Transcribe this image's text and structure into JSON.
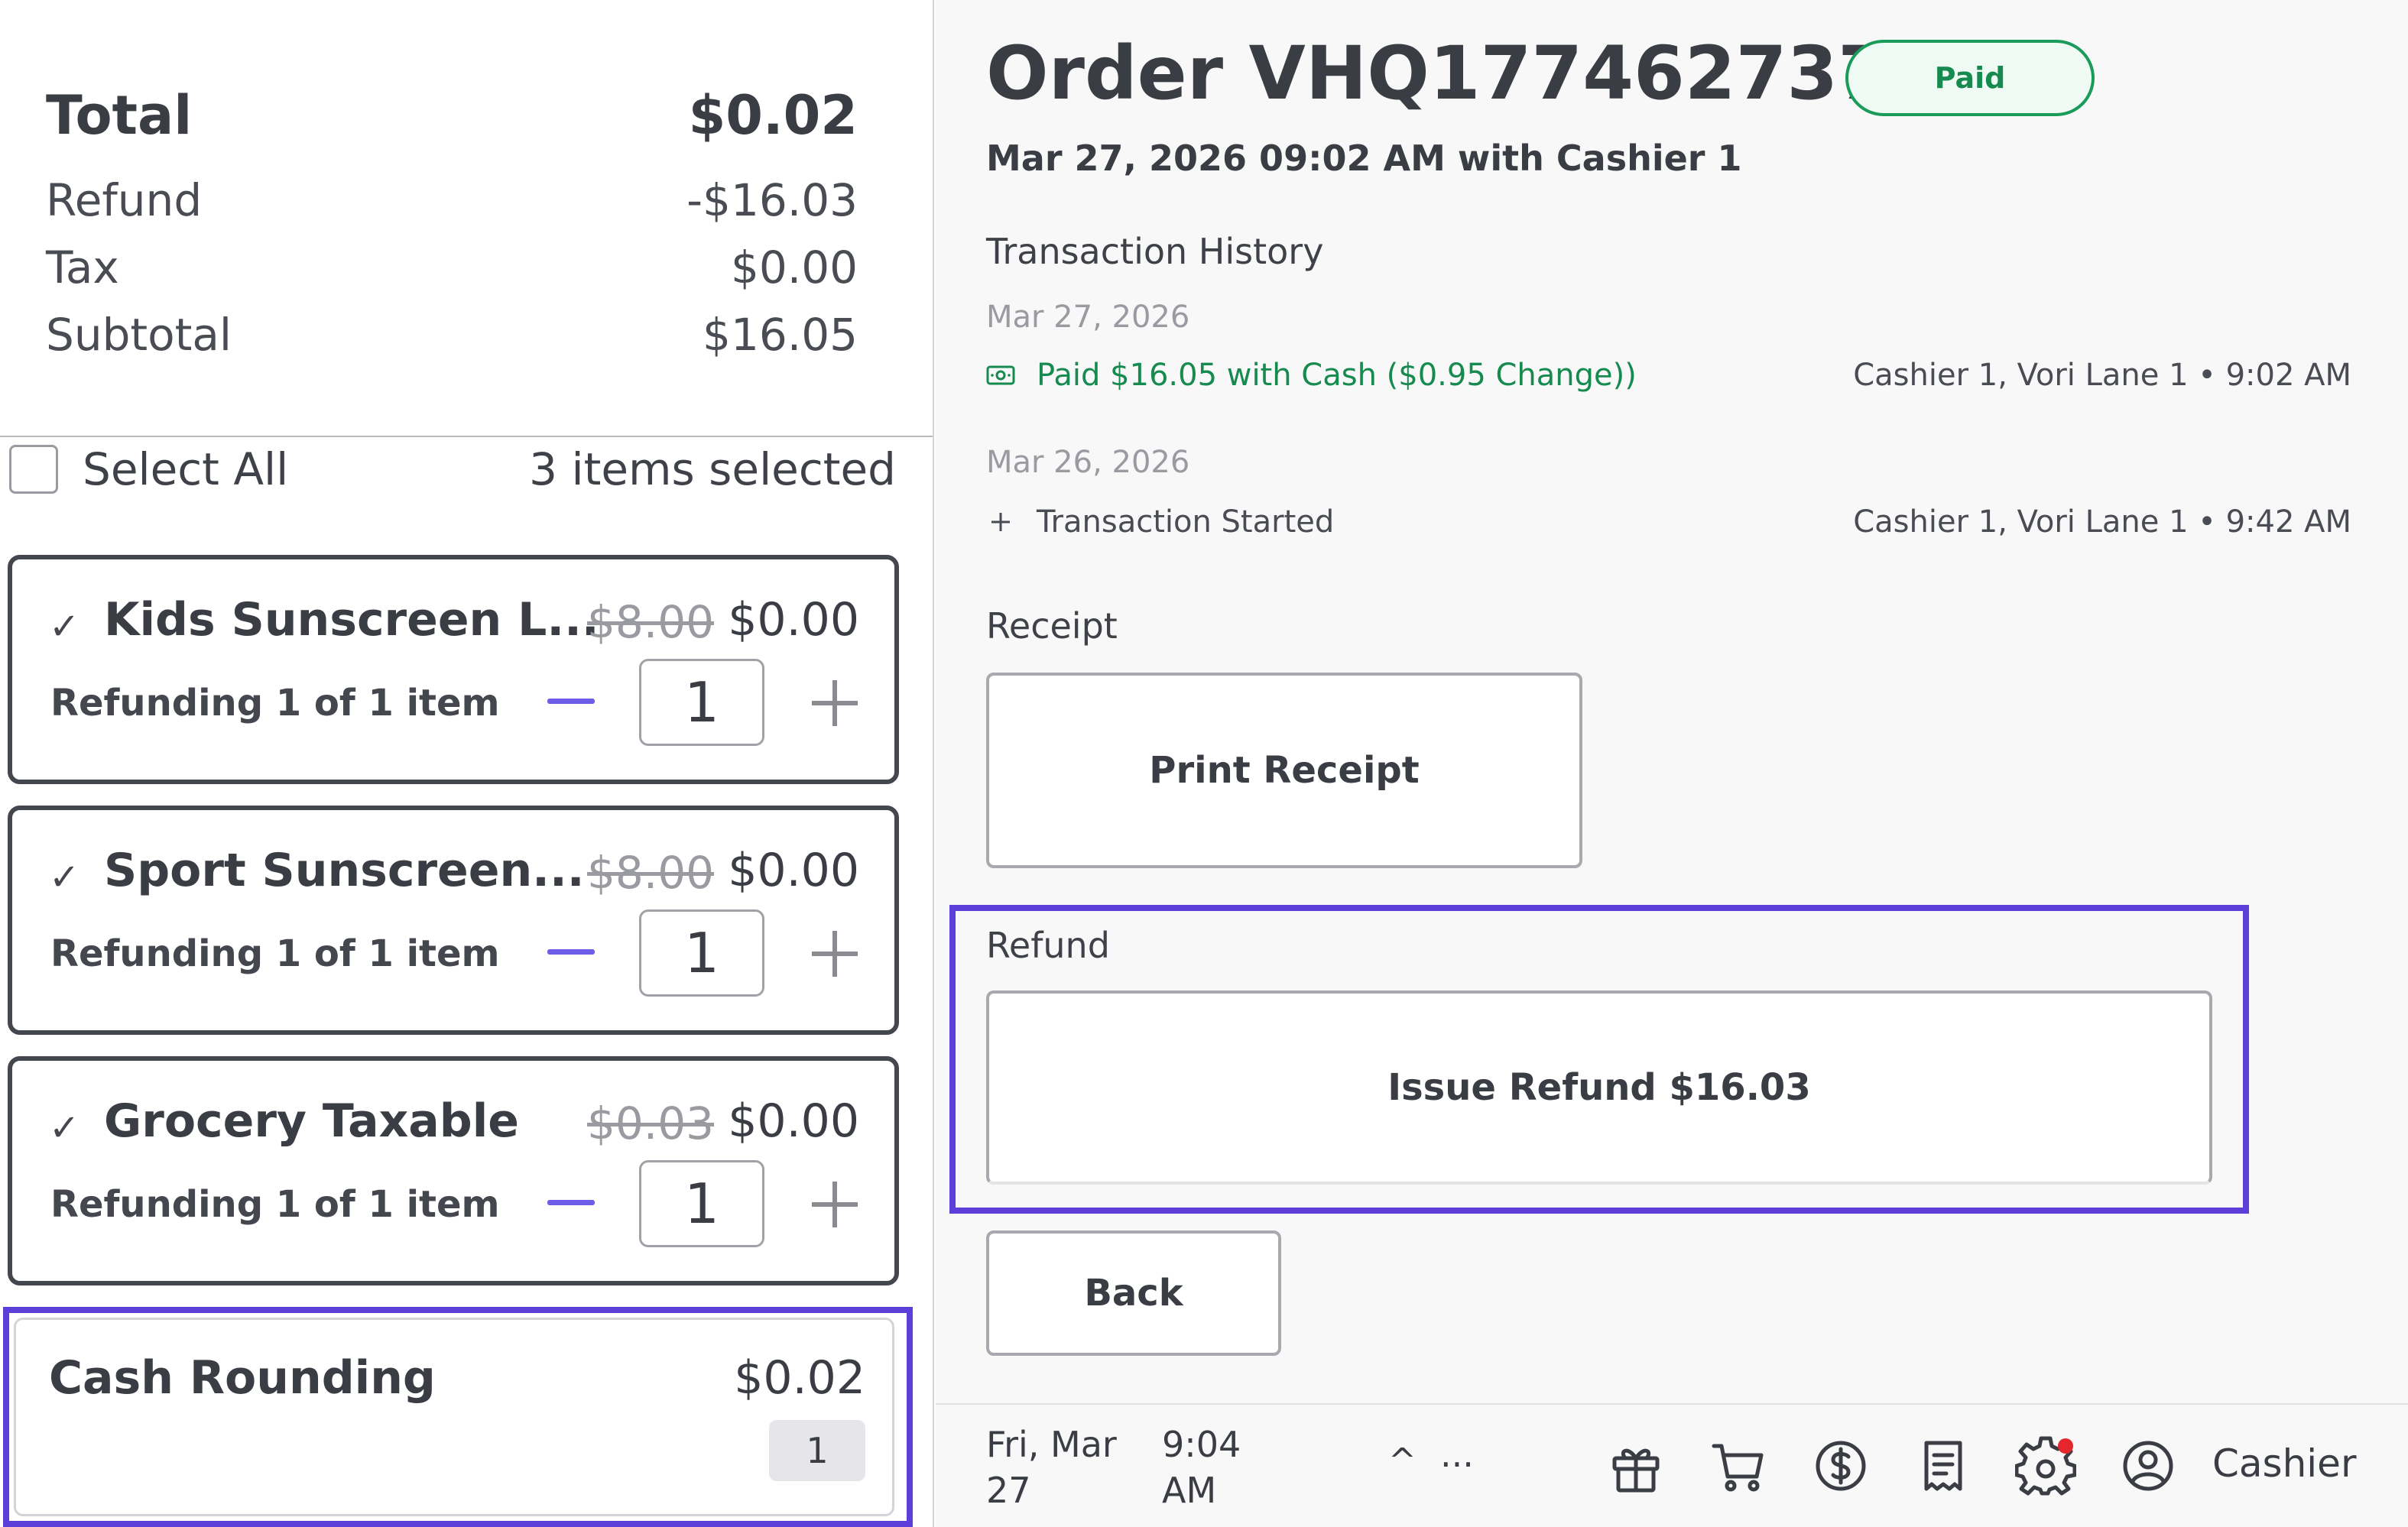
{
  "summary": {
    "total_label": "Total",
    "total_value": "$0.02",
    "refund_label": "Refund",
    "refund_value": "-$16.03",
    "tax_label": "Tax",
    "tax_value": "$0.00",
    "subtotal_label": "Subtotal",
    "subtotal_value": "$16.05"
  },
  "selection": {
    "select_all_label": "Select All",
    "count_label": "3 items selected"
  },
  "items": [
    {
      "name": "Kids Sunscreen L...",
      "original_price": "$8.00",
      "price": "$0.00",
      "refunding": "Refunding 1 of 1 item",
      "quantity": "1"
    },
    {
      "name": "Sport Sunscreen...",
      "original_price": "$8.00",
      "price": "$0.00",
      "refunding": "Refunding 1 of 1 item",
      "quantity": "1"
    },
    {
      "name": "Grocery Taxable",
      "original_price": "$0.03",
      "price": "$0.00",
      "refunding": "Refunding 1 of 1 item",
      "quantity": "1"
    }
  ],
  "cash_rounding": {
    "label": "Cash Rounding",
    "price": "$0.02",
    "quantity": "1"
  },
  "order": {
    "title": "Order VHQ1774627374",
    "status": "Paid",
    "subtitle": "Mar 27, 2026 09:02 AM with Cashier 1"
  },
  "transaction_history": {
    "heading": "Transaction History",
    "groups": [
      {
        "date": "Mar 27, 2026",
        "entry": "Paid $16.05 with Cash ($0.95 Change))",
        "meta": "Cashier 1, Vori Lane 1 • 9:02 AM",
        "icon": "cash-icon"
      },
      {
        "date": "Mar 26, 2026",
        "entry": "Transaction Started",
        "meta": "Cashier 1, Vori Lane 1 • 9:42 AM",
        "icon": "plus-icon"
      }
    ]
  },
  "receipt": {
    "heading": "Receipt",
    "print_label": "Print Receipt"
  },
  "refund": {
    "heading": "Refund",
    "issue_label": "Issue Refund $16.03"
  },
  "back_label": "Back",
  "bottom_bar": {
    "date": "Fri, Mar 27",
    "time": "9:04 AM",
    "caret": "^",
    "more": "...",
    "user": "Cashier",
    "icons": [
      "gift-icon",
      "cart-icon",
      "dollar-icon",
      "receipt-icon",
      "settings-icon",
      "user-icon"
    ]
  },
  "colors": {
    "accent": "#5b3fd8",
    "success": "#178a4f",
    "minus": "#6c5ce7",
    "notification": "#e5262d"
  }
}
